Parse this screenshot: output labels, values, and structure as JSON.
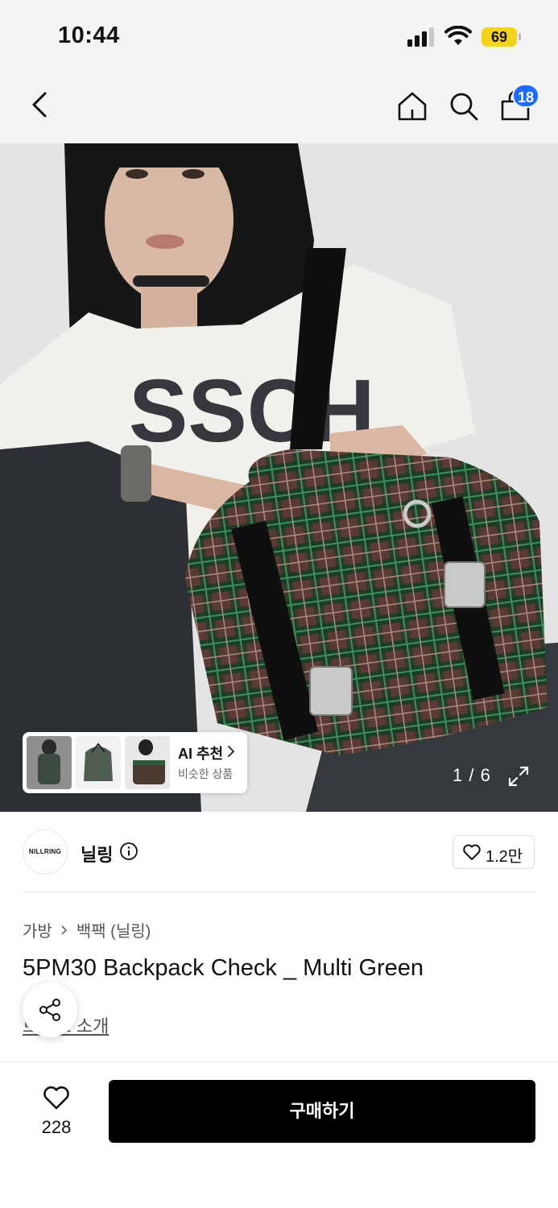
{
  "status_bar": {
    "time": "10:44",
    "battery_level": "69",
    "battery_color": "#f5d21b"
  },
  "nav": {
    "back_icon": "chevron-left-icon",
    "home_icon": "home-icon",
    "search_icon": "search-icon",
    "cart_icon": "shopping-bag-icon",
    "cart_count": "18",
    "badge_color": "#1f6bff"
  },
  "hero": {
    "page_indicator": "1 / 6",
    "ai_recommend": {
      "title": "AI 추천",
      "subtitle": "비슷한 상품"
    }
  },
  "brand": {
    "logo_text": "NILLRING",
    "name": "닐링",
    "like_count": "1.2만"
  },
  "product": {
    "category": "가방",
    "subcategory": "백팩 (닐링)",
    "title": "5PM30 Backpack Check _ Multi Green",
    "more_link": "브랜드 소개"
  },
  "bottom_bar": {
    "wish_count": "228",
    "buy_label": "구매하기",
    "buy_color": "#000000"
  }
}
